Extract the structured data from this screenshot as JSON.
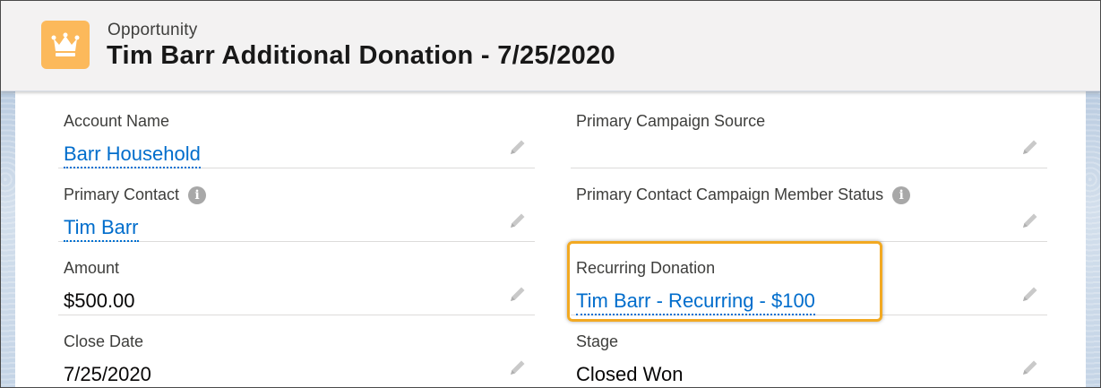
{
  "header": {
    "object_type": "Opportunity",
    "record_title": "Tim Barr Additional Donation - 7/25/2020",
    "icon": "crown-icon",
    "icon_color": "#fcb95b"
  },
  "fields": {
    "account_name": {
      "label": "Account Name",
      "value": "Barr Household"
    },
    "primary_campaign_source": {
      "label": "Primary Campaign Source",
      "value": ""
    },
    "primary_contact": {
      "label": "Primary Contact",
      "value": "Tim Barr"
    },
    "primary_contact_campaign_member_status": {
      "label": "Primary Contact Campaign Member Status",
      "value": ""
    },
    "amount": {
      "label": "Amount",
      "value": "$500.00"
    },
    "recurring_donation": {
      "label": "Recurring Donation",
      "value": "Tim Barr - Recurring - $100"
    },
    "close_date": {
      "label": "Close Date",
      "value": "7/25/2020"
    },
    "stage": {
      "label": "Stage",
      "value": "Closed Won"
    }
  },
  "colors": {
    "link": "#006dcc",
    "highlight": "#f2a922"
  }
}
